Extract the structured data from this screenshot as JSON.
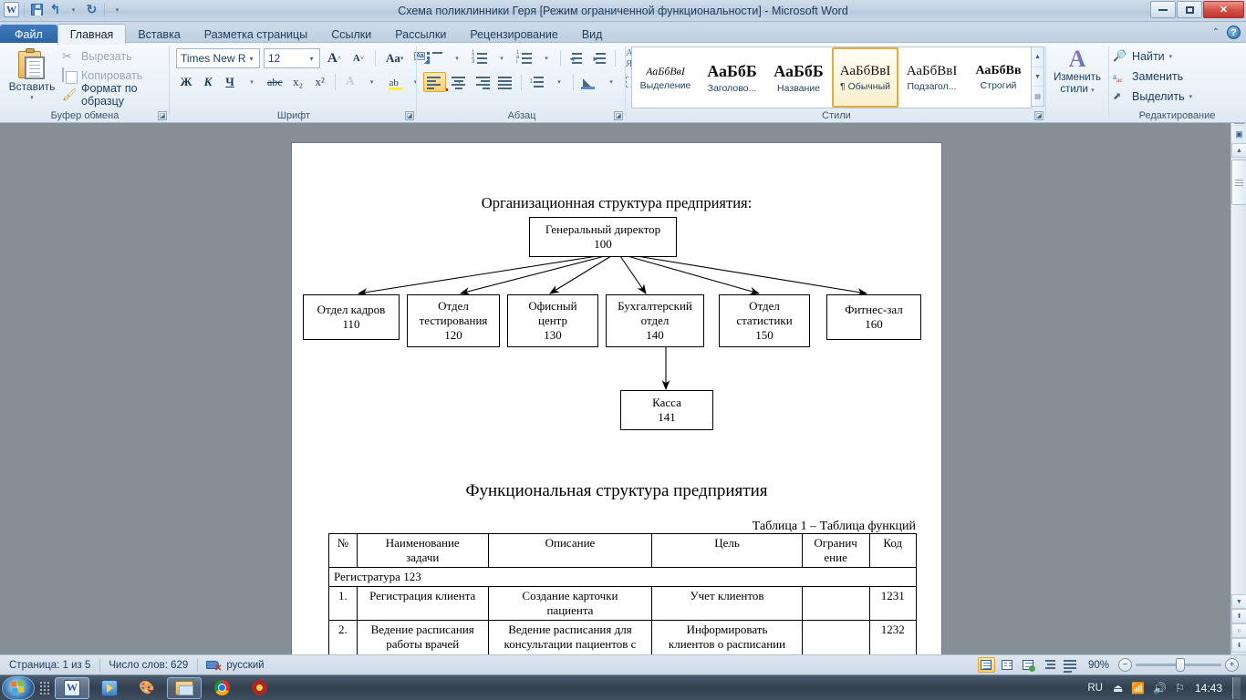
{
  "titlebar": {
    "title": "Схема поликлинники Геря [Режим ограниченной функциональности]  -  Microsoft Word",
    "logo": "W",
    "qat": [
      "save-icon",
      "undo-icon",
      "redo-icon",
      "customize-qat-icon"
    ],
    "minimize": "minimize-icon",
    "restore": "restore-icon",
    "close": "✕"
  },
  "tabs": [
    {
      "label": "Файл",
      "kind": "file"
    },
    {
      "label": "Главная",
      "kind": "active"
    },
    {
      "label": "Вставка",
      "kind": "normal"
    },
    {
      "label": "Разметка страницы",
      "kind": "normal"
    },
    {
      "label": "Ссылки",
      "kind": "normal"
    },
    {
      "label": "Рассылки",
      "kind": "normal"
    },
    {
      "label": "Рецензирование",
      "kind": "normal"
    },
    {
      "label": "Вид",
      "kind": "normal"
    }
  ],
  "ribbon_right": {
    "collapse": "⌃",
    "help": "?"
  },
  "clipboard": {
    "group_label": "Буфер обмена",
    "paste_label": "Вставить",
    "items": [
      {
        "label": "Вырезать",
        "icon": "scissors-icon",
        "enabled": false
      },
      {
        "label": "Копировать",
        "icon": "copy-icon",
        "enabled": false
      },
      {
        "label": "Формат по образцу",
        "icon": "format-painter-icon",
        "enabled": true
      }
    ]
  },
  "font": {
    "group_label": "Шрифт",
    "name": "Times New Rc",
    "size": "12",
    "grow": "A",
    "shrink": "A",
    "case_label": "Aa",
    "clear_format": "clear-formatting-icon",
    "bold": "Ж",
    "italic": "К",
    "underline": "Ч",
    "strike": "abc",
    "subscript": "x₂",
    "superscript": "x²",
    "text_effects": "A",
    "highlight": "ab",
    "font_color": "A"
  },
  "paragraph": {
    "group_label": "Абзац",
    "bullets": "bulleted-list-icon",
    "numbering": "numbered-list-icon",
    "multilevel": "multilevel-list-icon",
    "decrease_indent": "decrease-indent-icon",
    "increase_indent": "increase-indent-icon",
    "sort": "sort-icon",
    "show_marks": "¶",
    "align_left": "align-left-icon",
    "align_center": "align-center-icon",
    "align_right": "align-right-icon",
    "align_justify": "align-justify-icon",
    "line_spacing": "line-spacing-icon",
    "shading": "shading-icon",
    "borders": "borders-icon",
    "active_alignment": "align_left"
  },
  "styles": {
    "group_label": "Стили",
    "items": [
      {
        "preview": "АаБбВвI",
        "name": "Выделение",
        "variant": "em",
        "selected": false
      },
      {
        "preview": "АаБбБ",
        "name": "Заголово...",
        "variant": "h1",
        "selected": false
      },
      {
        "preview": "АаБбБ",
        "name": "Название",
        "variant": "h1",
        "selected": false
      },
      {
        "preview": "АаБбВвI",
        "name": "¶ Обычный",
        "variant": "normal",
        "selected": true
      },
      {
        "preview": "АаБбВвI",
        "name": "Подзагол...",
        "variant": "normal",
        "selected": false
      },
      {
        "preview": "АаБбВв",
        "name": "Строгий",
        "variant": "strong",
        "selected": false
      }
    ],
    "change_styles": "Изменить\nстили"
  },
  "change_styles": {
    "line1": "Изменить",
    "line2": "стили"
  },
  "editing": {
    "group_label": "Редактирование",
    "items": [
      {
        "label": "Найти",
        "icon": "find-icon",
        "has_caret": true
      },
      {
        "label": "Заменить",
        "icon": "replace-icon",
        "has_caret": false
      },
      {
        "label": "Выделить",
        "icon": "select-icon",
        "has_caret": true
      }
    ]
  },
  "document": {
    "heading_org": "Организационная структура предприятия:",
    "heading_func": "Функциональная структура предприятия",
    "table_caption": "Таблица 1 – Таблица функций",
    "org_chart": {
      "root": {
        "title": "Генеральный  директор",
        "code": "100"
      },
      "departments": [
        {
          "title": "Отдел кадров",
          "code": "110"
        },
        {
          "title": "Отдел\nтестирования",
          "code": "120"
        },
        {
          "title": "Офисный\nцентр",
          "code": "130"
        },
        {
          "title": "Бухгалтерский\nотдел",
          "code": "140"
        },
        {
          "title": "Отдел\nстатистики",
          "code": "150"
        },
        {
          "title": "Фитнес-зал",
          "code": "160"
        }
      ],
      "sub": {
        "title": "Касса",
        "code": "141",
        "parent_code": "140"
      }
    },
    "table": {
      "headers": [
        "№",
        "Наименование\nзадачи",
        "Описание",
        "Цель",
        "Огранич\nение",
        "Код"
      ],
      "section": "Регистратура 123",
      "rows": [
        {
          "num": "1.",
          "name": "Регистрация клиента",
          "desc": "Создание карточки\nпациента",
          "goal": "Учет клиентов",
          "limit": "",
          "code": "1231"
        },
        {
          "num": "2.",
          "name": "Ведение расписания\nработы врачей",
          "desc": "Ведение расписания для\nконсультации пациентов с\nпоследующей  записью на\nприем",
          "goal": "Информировать\nклиентов о расписании\nработы врачей;",
          "limit": "",
          "code": "1232"
        }
      ]
    }
  },
  "statusbar": {
    "page": "Страница: 1 из 5",
    "words": "Число слов: 629",
    "language": "русский",
    "proofing_icon": "proofing-errors-icon",
    "views": [
      {
        "name": "print-layout-view",
        "selected": true
      },
      {
        "name": "full-screen-reading-view",
        "selected": false
      },
      {
        "name": "web-layout-view",
        "selected": false
      },
      {
        "name": "outline-view",
        "selected": false
      },
      {
        "name": "draft-view",
        "selected": false
      }
    ],
    "zoom": "90%",
    "zoom_out": "−",
    "zoom_in": "+"
  },
  "taskbar": {
    "start": "start-orb-icon",
    "items": [
      {
        "name": "taskbar-word",
        "icon": "word-icon",
        "state": "active"
      },
      {
        "name": "taskbar-media-player",
        "icon": "media-player-icon",
        "state": "normal"
      },
      {
        "name": "taskbar-paint",
        "icon": "paint-icon",
        "state": "normal"
      },
      {
        "name": "taskbar-explorer",
        "icon": "folder-icon",
        "state": "running"
      },
      {
        "name": "taskbar-chrome",
        "icon": "chrome-icon",
        "state": "normal"
      },
      {
        "name": "taskbar-opera",
        "icon": "opera-icon",
        "state": "normal"
      }
    ],
    "tray": {
      "language": "RU",
      "icons": [
        "usb-eject-icon",
        "network-icon",
        "volume-icon",
        "action-center-icon"
      ],
      "clock": "14:43"
    }
  },
  "colors": {
    "accent": "#2a5699",
    "selection": "#ffd06a",
    "close_button": "#c0352e",
    "doc_background": "#868e96"
  }
}
